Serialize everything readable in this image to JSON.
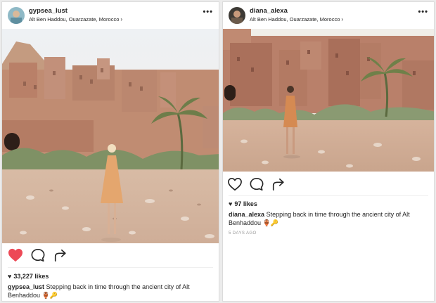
{
  "posts": [
    {
      "username": "gypsea_lust",
      "location": "Alt Ben Haddou, Ouarzazate, Morocco",
      "location_chevron": "›",
      "more": "•••",
      "likes_icon": "♥",
      "likes": "33,227 likes",
      "liked": true,
      "caption_user": "gypsea_lust",
      "caption_text": "Stepping back in time through the ancient city of Alt Benhaddou 🏺🔑"
    },
    {
      "username": "diana_alexa",
      "location": "Alt Ben Haddou, Ouarzazate, Morocco",
      "location_chevron": "›",
      "more": "•••",
      "likes_icon": "♥",
      "likes": "97 likes",
      "liked": false,
      "caption_user": "diana_alexa",
      "caption_text": "Stepping back in time through the ancient city of Alt Benhaddou 🏺🔑",
      "timestamp": "5 DAYS AGO"
    }
  ],
  "icons": {
    "like": "heart-icon",
    "comment": "comment-icon",
    "share": "share-icon",
    "more": "more-options-icon"
  },
  "colors": {
    "liked_heart": "#ed4956",
    "icon_stroke": "#262626",
    "timestamp": "#999999"
  }
}
